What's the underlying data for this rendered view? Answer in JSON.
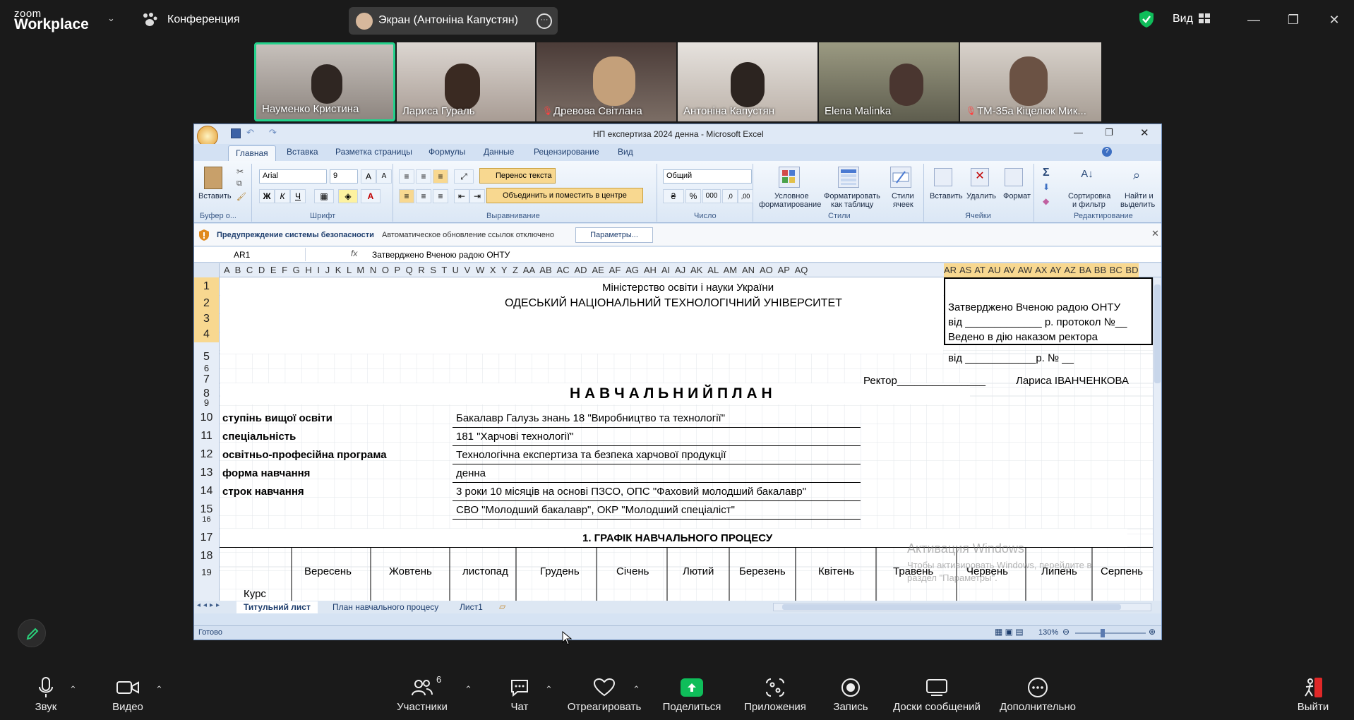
{
  "zoom": {
    "logo_top": "zoom",
    "logo_bottom": "Workplace",
    "conference_label": "Конференция",
    "screen_share_label": "Экран (Антоніна Капустян)",
    "view_label": "Вид",
    "participants": [
      {
        "name": "Науменко Кристина",
        "muted": false,
        "active": true
      },
      {
        "name": "Лариса Гураль",
        "muted": false,
        "active": false
      },
      {
        "name": "Древова Світлана",
        "muted": true,
        "active": false
      },
      {
        "name": "Антоніна Капустян",
        "muted": false,
        "active": false
      },
      {
        "name": "Elena Malinka",
        "muted": false,
        "active": false
      },
      {
        "name": "ТМ-35а Кіцелюк Мик...",
        "muted": true,
        "active": false
      }
    ],
    "toolbar": {
      "sound": "Звук",
      "video": "Видео",
      "participants": "Участники",
      "participants_count": "6",
      "chat": "Чат",
      "react": "Отреагировать",
      "share": "Поделиться",
      "apps": "Приложения",
      "record": "Запись",
      "whiteboards": "Доски сообщений",
      "more": "Дополнительно",
      "leave": "Выйти"
    },
    "colors": {
      "share_green": "#0fbd5a",
      "leave_red": "#e02828",
      "active_speaker": "#23d18b"
    }
  },
  "excel": {
    "title": "НП експертиза 2024 денна - Microsoft Excel",
    "tabs": [
      "Главная",
      "Вставка",
      "Разметка страницы",
      "Формулы",
      "Данные",
      "Рецензирование",
      "Вид"
    ],
    "ribbon": {
      "paste": "Вставить",
      "clipboard_group": "Буфер о...",
      "font_name": "Arial",
      "font_size": "9",
      "font_group": "Шрифт",
      "bold": "Ж",
      "italic": "К",
      "underline": "Ч",
      "wrap_text": "Перенос текста",
      "merge_center": "Объединить и поместить в центре",
      "alignment_group": "Выравнивание",
      "number_format": "Общий",
      "number_group": "Число",
      "percent": "%",
      "thousands": "000",
      "cond_format_1": "Условное",
      "cond_format_2": "форматирование",
      "format_table_1": "Форматировать",
      "format_table_2": "как таблицу",
      "cell_styles_1": "Стили",
      "cell_styles_2": "ячеек",
      "styles_group": "Стили",
      "insert": "Вставить",
      "delete": "Удалить",
      "format": "Формат",
      "cells_group": "Ячейки",
      "sum": "Σ",
      "sort_1": "Сортировка",
      "sort_2": "и фильтр",
      "find_1": "Найти и",
      "find_2": "выделить",
      "editing_group": "Редактирование"
    },
    "security": {
      "title": "Предупреждение системы безопасности",
      "message": "Автоматическое обновление ссылок отключено",
      "button": "Параметры..."
    },
    "name_box": "AR1",
    "formula": "Затверджено Вченою радою ОНТУ",
    "fx": "fx",
    "columns": "A B C D E F G H I J K L M N O P Q R S T U V W X Y Z AA AB AC AD AE AF AG AH AI AJ AK AL AM AN AO AP AQ",
    "selected_columns": "AR AS AT AU AV AW AX AY AZ BA BB BC BD",
    "rows": [
      "1",
      "2",
      "3",
      "4",
      "5",
      "6",
      "7",
      "8",
      "9",
      "10",
      "11",
      "12",
      "13",
      "14",
      "15",
      "16",
      "17",
      "18",
      "19"
    ],
    "cells": {
      "ministry": "Міністерство освіти і науки України",
      "university": "ОДЕСЬКИЙ  НАЦІОНАЛЬНИЙ  ТЕХНОЛОГІЧНИЙ УНІВЕРСИТЕТ",
      "approved": "Затверджено Вченою радою ОНТУ",
      "protocol": "від _____________ р. протокол №__",
      "enacted": "Ведено в дію наказом ректора",
      "order_date": "від ____________р. № __",
      "rector": "Ректор_______________",
      "rector_name": "Лариса ІВАНЧЕНКОВА",
      "plan_title": "Н А В Ч А Л Ь Н И Й   П Л А Н",
      "r10_label": "ступінь вищої освіти",
      "r10_value": "Бакалавр     Галузь знань   18 \"Виробництво та технології\"",
      "r11_label": "спеціальність",
      "r11_value": "181 \"Харчові технології\"",
      "r12_label": "освітньо-професійна програма",
      "r12_value": "Технологічна експертиза та безпека харчової продукції",
      "r13_label": "форма навчання",
      "r13_value": "денна",
      "r14_label": "строк навчання",
      "r14_value": "3 роки  10 місяців на основі ПЗСО, ОПС \"Фаховий молодший бакалавр\"",
      "r15_value": "СВО \"Молодший бакалавр\", ОКР \"Молодший спеціаліст\"",
      "schedule_title": "1. ГРАФІК НАВЧАЛЬНОГО ПРОЦЕСУ",
      "course": "Курс",
      "months": [
        "Вересень",
        "Жовтень",
        "листопад",
        "Грудень",
        "Січень",
        "Лютий",
        "Березень",
        "Квітень",
        "Травень",
        "Червень",
        "Липень",
        "Серпень"
      ]
    },
    "sheets": [
      "Титульний лист",
      "План навчального процесу",
      "Лист1"
    ],
    "status": "Готово",
    "zoom_level": "130%",
    "activation_1": "Активация Windows",
    "activation_2": "Чтобы активировать Windows, перейдите в",
    "activation_3": "раздел \"Параметры\"."
  }
}
